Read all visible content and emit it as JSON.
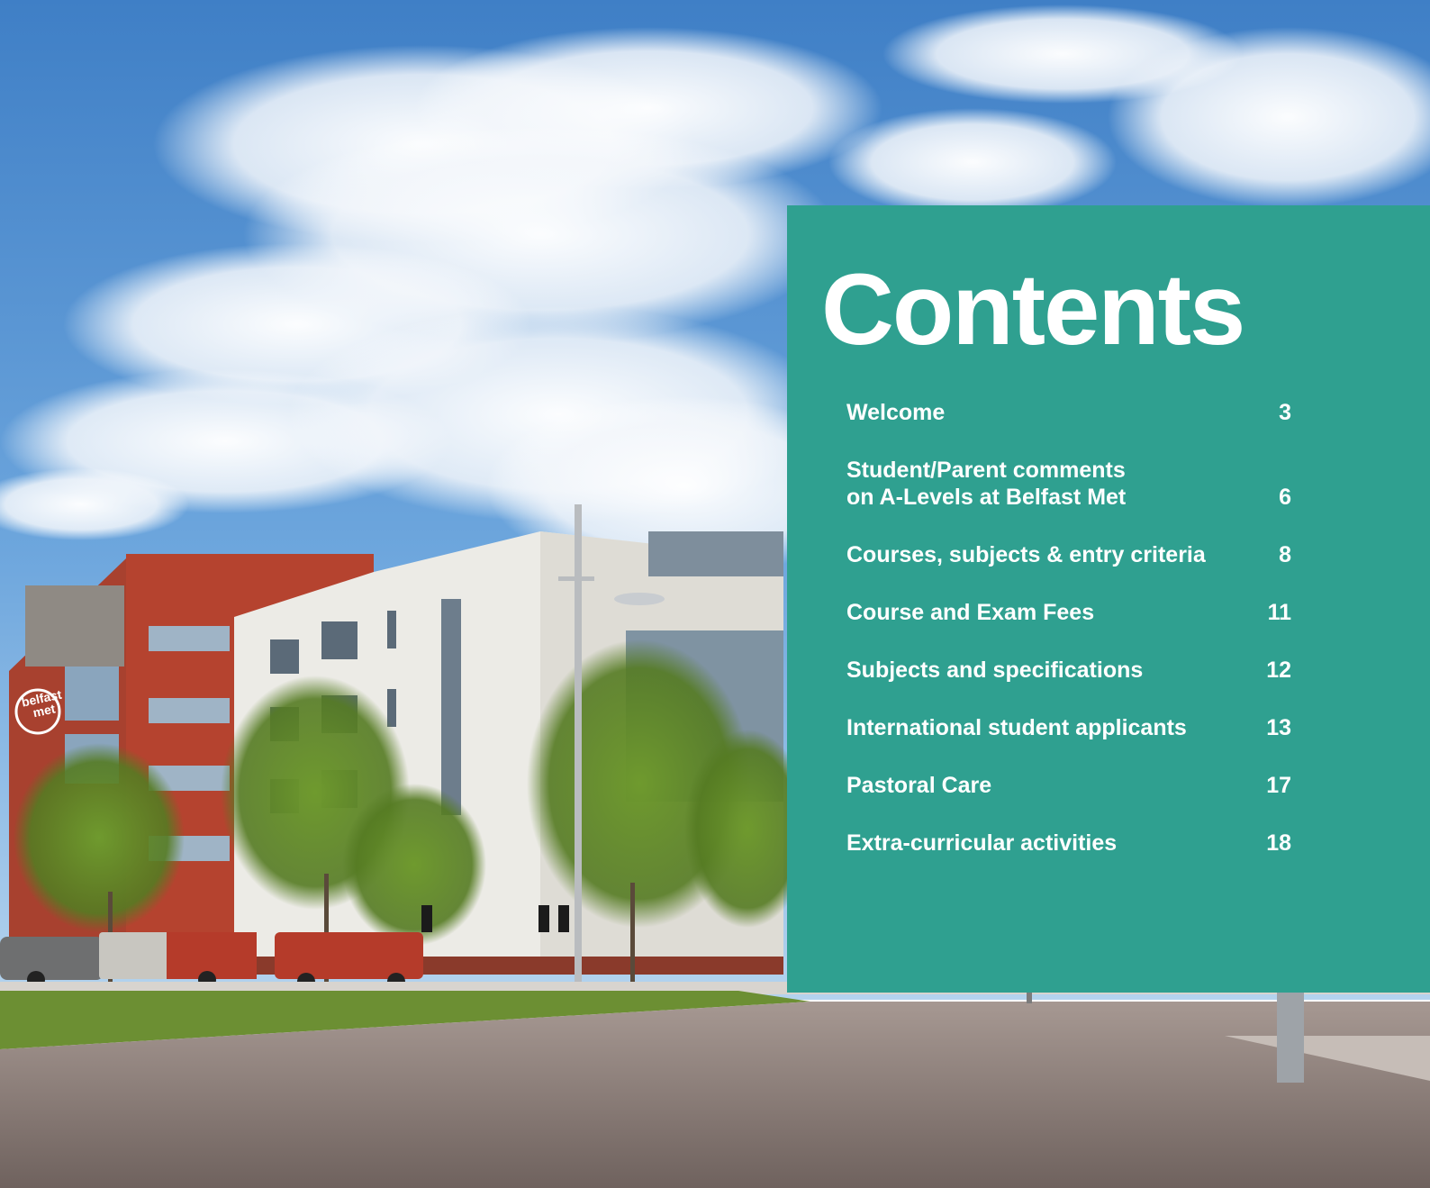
{
  "title": "Contents",
  "toc": [
    {
      "lines": [
        "Welcome"
      ],
      "page": "3"
    },
    {
      "lines": [
        "Student/Parent comments",
        "on A-Levels at Belfast Met"
      ],
      "page": "6"
    },
    {
      "lines": [
        "Courses, subjects & entry criteria"
      ],
      "page": "8"
    },
    {
      "lines": [
        "Course and Exam Fees"
      ],
      "page": "11"
    },
    {
      "lines": [
        "Subjects and specifications"
      ],
      "page": "12"
    },
    {
      "lines": [
        "International student applicants"
      ],
      "page": "13"
    },
    {
      "lines": [
        "Pastoral Care"
      ],
      "page": "17"
    },
    {
      "lines": [
        "Extra-curricular activities"
      ],
      "page": "18"
    }
  ],
  "photo": {
    "building_sign": [
      "belfast",
      "met"
    ]
  },
  "colors": {
    "panel": "#2fa090",
    "sky": "#5b9ad6",
    "brick": "#b5432f"
  }
}
